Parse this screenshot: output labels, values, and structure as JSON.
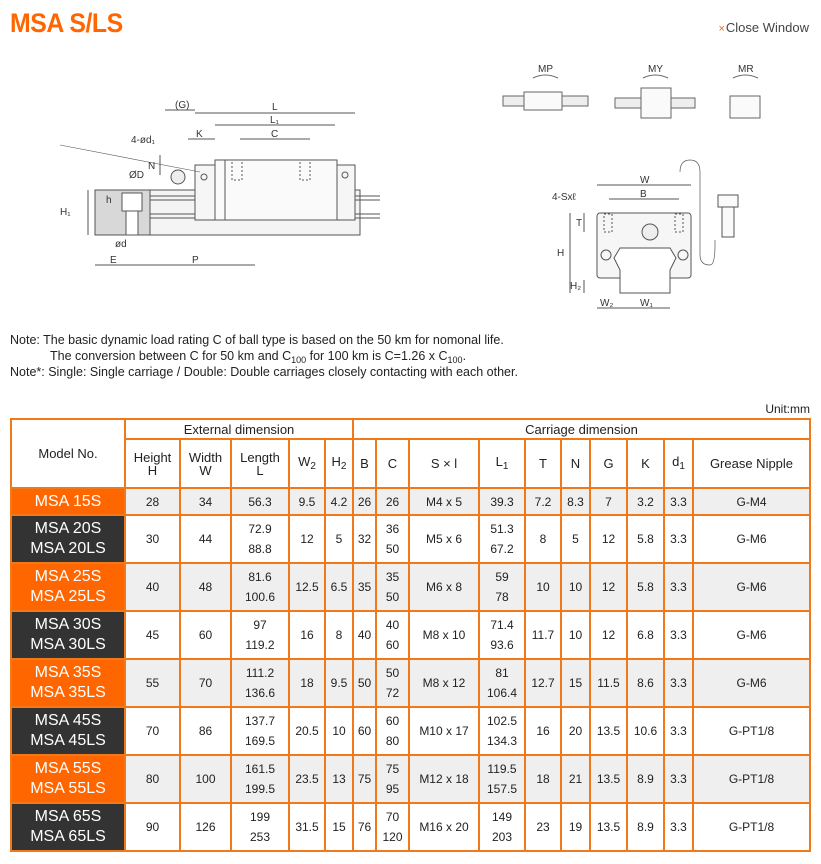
{
  "page": {
    "title": "MSA S/LS",
    "close_label": "Close Window",
    "close_icon": "×"
  },
  "diagram": {
    "side_view_labels": {
      "G": "(G)",
      "L": "L",
      "L1": "L₁",
      "C": "C",
      "K": "K",
      "d1": "4-ød₁",
      "N": "N",
      "D": "ØD",
      "h": "h",
      "H1": "H₁",
      "d": "ød",
      "E": "E",
      "P": "P"
    },
    "moment_labels": [
      "MP",
      "MY",
      "MR"
    ],
    "front_view_labels": {
      "W": "W",
      "B": "B",
      "S": "4-Sxℓ",
      "T": "T",
      "H": "H",
      "H2": "H₂",
      "W2": "W₂",
      "W1": "W₁"
    }
  },
  "notes": {
    "line1": "Note: The basic dynamic load rating C of ball type is based on the 50 km for nomonal life.",
    "line2_a": "The conversion between C for 50 km and C",
    "line2_sub1": "100",
    "line2_b": " for 100 km is C=1.26 x C",
    "line2_sub2": "100",
    "line2_c": ".",
    "line3": "Note*: Single: Single carriage / Double: Double carriages closely contacting with each other."
  },
  "table": {
    "unit": "Unit:mm",
    "model_header": "Model No.",
    "group_external": "External dimension",
    "group_carriage": "Carriage dimension",
    "columns": [
      {
        "key": "H",
        "label": "Height",
        "label2": "H"
      },
      {
        "key": "W",
        "label": "Width",
        "label2": "W"
      },
      {
        "key": "L",
        "label": "Length",
        "label2": "L"
      },
      {
        "key": "W2",
        "label": "W",
        "sub": "2"
      },
      {
        "key": "H2",
        "label": "H",
        "sub": "2"
      },
      {
        "key": "B",
        "label": "B"
      },
      {
        "key": "C",
        "label": "C"
      },
      {
        "key": "Sxl",
        "label": "S × l"
      },
      {
        "key": "L1",
        "label": "L",
        "sub": "1"
      },
      {
        "key": "T",
        "label": "T"
      },
      {
        "key": "N",
        "label": "N"
      },
      {
        "key": "G",
        "label": "G"
      },
      {
        "key": "K",
        "label": "K"
      },
      {
        "key": "d1",
        "label": "d",
        "sub": "1"
      },
      {
        "key": "nipple",
        "label": "Grease Nipple"
      }
    ],
    "rows": [
      {
        "models": [
          "MSA 15S"
        ],
        "H": "28",
        "W": "34",
        "L": [
          "56.3"
        ],
        "W2": "9.5",
        "H2": "4.2",
        "B": "26",
        "C": [
          "26"
        ],
        "Sxl": "M4 x 5",
        "L1": [
          "39.3"
        ],
        "T": "7.2",
        "N": "8.3",
        "G": "7",
        "K": "3.2",
        "d1": "3.3",
        "nipple": "G-M4"
      },
      {
        "models": [
          "MSA 20S",
          "MSA 20LS"
        ],
        "H": "30",
        "W": "44",
        "L": [
          "72.9",
          "88.8"
        ],
        "W2": "12",
        "H2": "5",
        "B": "32",
        "C": [
          "36",
          "50"
        ],
        "Sxl": "M5 x 6",
        "L1": [
          "51.3",
          "67.2"
        ],
        "T": "8",
        "N": "5",
        "G": "12",
        "K": "5.8",
        "d1": "3.3",
        "nipple": "G-M6"
      },
      {
        "models": [
          "MSA 25S",
          "MSA 25LS"
        ],
        "H": "40",
        "W": "48",
        "L": [
          "81.6",
          "100.6"
        ],
        "W2": "12.5",
        "H2": "6.5",
        "B": "35",
        "C": [
          "35",
          "50"
        ],
        "Sxl": "M6 x 8",
        "L1": [
          "59",
          "78"
        ],
        "T": "10",
        "N": "10",
        "G": "12",
        "K": "5.8",
        "d1": "3.3",
        "nipple": "G-M6"
      },
      {
        "models": [
          "MSA 30S",
          "MSA 30LS"
        ],
        "H": "45",
        "W": "60",
        "L": [
          "97",
          "119.2"
        ],
        "W2": "16",
        "H2": "8",
        "B": "40",
        "C": [
          "40",
          "60"
        ],
        "Sxl": "M8 x 10",
        "L1": [
          "71.4",
          "93.6"
        ],
        "T": "11.7",
        "N": "10",
        "G": "12",
        "K": "6.8",
        "d1": "3.3",
        "nipple": "G-M6"
      },
      {
        "models": [
          "MSA 35S",
          "MSA 35LS"
        ],
        "H": "55",
        "W": "70",
        "L": [
          "111.2",
          "136.6"
        ],
        "W2": "18",
        "H2": "9.5",
        "B": "50",
        "C": [
          "50",
          "72"
        ],
        "Sxl": "M8 x 12",
        "L1": [
          "81",
          "106.4"
        ],
        "T": "12.7",
        "N": "15",
        "G": "11.5",
        "K": "8.6",
        "d1": "3.3",
        "nipple": "G-M6"
      },
      {
        "models": [
          "MSA 45S",
          "MSA 45LS"
        ],
        "H": "70",
        "W": "86",
        "L": [
          "137.7",
          "169.5"
        ],
        "W2": "20.5",
        "H2": "10",
        "B": "60",
        "C": [
          "60",
          "80"
        ],
        "Sxl": "M10 x 17",
        "L1": [
          "102.5",
          "134.3"
        ],
        "T": "16",
        "N": "20",
        "G": "13.5",
        "K": "10.6",
        "d1": "3.3",
        "nipple": "G-PT1/8"
      },
      {
        "models": [
          "MSA 55S",
          "MSA 55LS"
        ],
        "H": "80",
        "W": "100",
        "L": [
          "161.5",
          "199.5"
        ],
        "W2": "23.5",
        "H2": "13",
        "B": "75",
        "C": [
          "75",
          "95"
        ],
        "Sxl": "M12 x 18",
        "L1": [
          "119.5",
          "157.5"
        ],
        "T": "18",
        "N": "21",
        "G": "13.5",
        "K": "8.9",
        "d1": "3.3",
        "nipple": "G-PT1/8"
      },
      {
        "models": [
          "MSA 65S",
          "MSA 65LS"
        ],
        "H": "90",
        "W": "126",
        "L": [
          "199",
          "253"
        ],
        "W2": "31.5",
        "H2": "15",
        "B": "76",
        "C": [
          "70",
          "120"
        ],
        "Sxl": "M16 x 20",
        "L1": [
          "149",
          "203"
        ],
        "T": "23",
        "N": "19",
        "G": "13.5",
        "K": "8.9",
        "d1": "3.3",
        "nipple": "G-PT1/8"
      }
    ]
  }
}
